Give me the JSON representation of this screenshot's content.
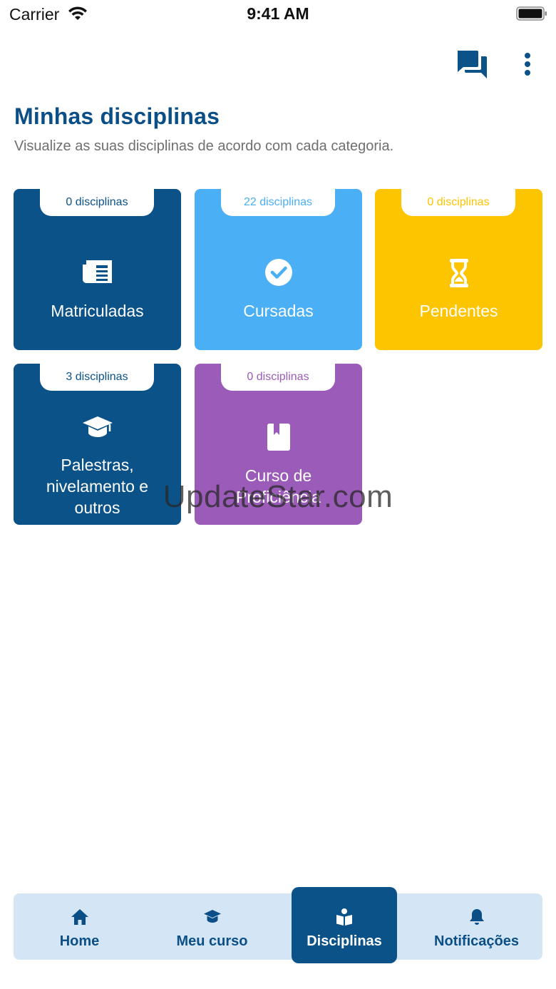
{
  "status_bar": {
    "carrier": "Carrier",
    "time": "9:41 AM"
  },
  "header": {
    "icons": [
      "chat-icon",
      "more-vertical-icon"
    ],
    "title": "Minhas disciplinas",
    "subtitle": "Visualize as suas disciplinas de acordo com cada categoria."
  },
  "cards": [
    {
      "count": "0 disciplinas",
      "label": "Matriculadas",
      "icon": "newspaper-icon",
      "color": "#0b5289"
    },
    {
      "count": "22 disciplinas",
      "label": "Cursadas",
      "icon": "check-circle-icon",
      "color": "#4aaff5"
    },
    {
      "count": "0 disciplinas",
      "label": "Pendentes",
      "icon": "hourglass-icon",
      "color": "#fdc400"
    },
    {
      "count": "3 disciplinas",
      "label_lines": [
        "Palestras,",
        "nivelamento e",
        "outros"
      ],
      "icon": "graduation-cap-icon",
      "color": "#0b5289"
    },
    {
      "count": "0 disciplinas",
      "label_lines": [
        "Curso de",
        "Proficiência"
      ],
      "icon": "bookmark-book-icon",
      "color": "#9b5bb8"
    }
  ],
  "watermark": "UpdateStar.com",
  "bottom_nav": {
    "items": [
      {
        "label": "Home",
        "icon": "home-icon"
      },
      {
        "label": "Meu curso",
        "icon": "graduation-cap-icon"
      },
      {
        "label": "Disciplinas",
        "icon": "book-reader-icon",
        "active": true
      },
      {
        "label": "Notificações",
        "icon": "bell-icon"
      }
    ],
    "background": "#d4e6f6",
    "active_color": "#0b5289"
  }
}
